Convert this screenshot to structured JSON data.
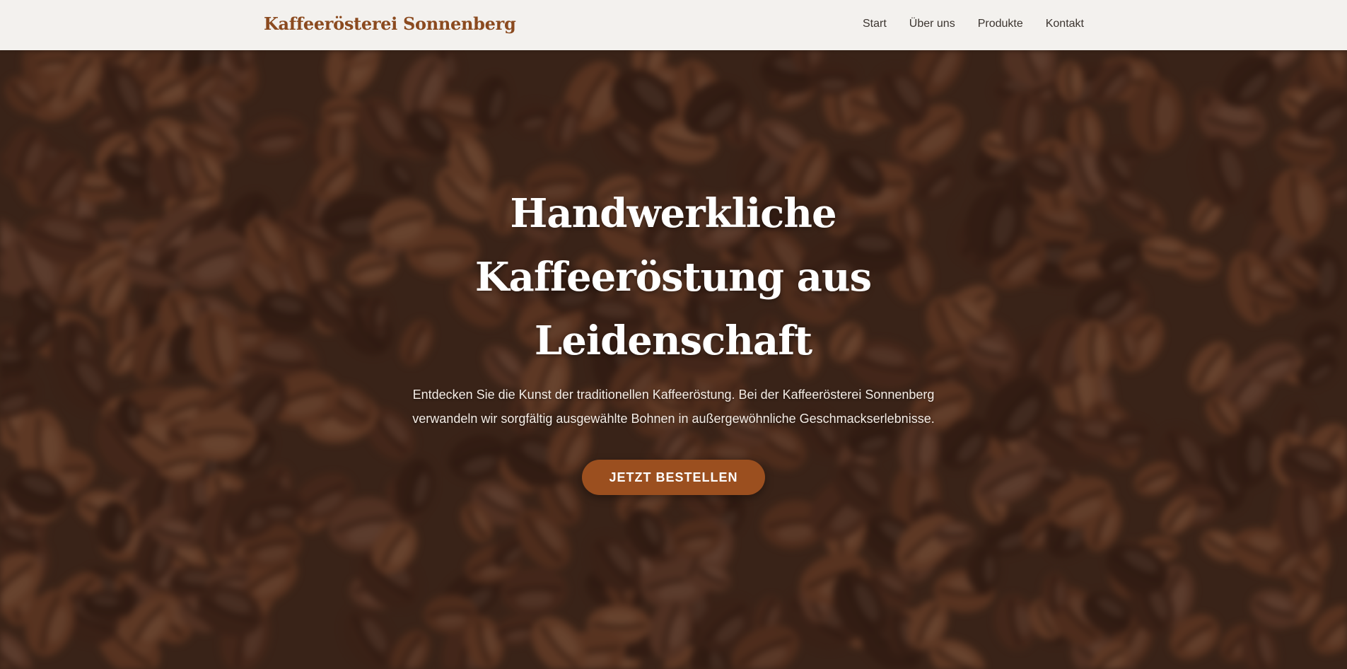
{
  "brand": "Kaffeerösterei Sonnenberg",
  "nav": {
    "start": "Start",
    "about": "Über uns",
    "products": "Produkte",
    "contact": "Kontakt"
  },
  "hero": {
    "title": "Handwerkliche Kaffeeröstung aus Leidenschaft",
    "subtitle": "Entdecken Sie die Kunst der traditionellen Kaffeeröstung. Bei der Kaffeerösterei Sonnenberg verwandeln wir sorgfältig ausgewählte Bohnen in außergewöhnliche Geschmackserlebnisse.",
    "cta": "JETZT BESTELLEN",
    "background": "coffee-beans-photo"
  },
  "colors": {
    "brand": "#8b4a1f",
    "cta": "#9b4f1f",
    "navbar": "#f3f1ee"
  }
}
